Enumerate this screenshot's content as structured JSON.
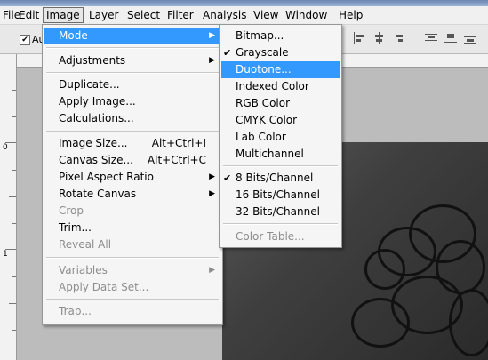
{
  "menubar": {
    "items": [
      "File",
      "Edit",
      "Image",
      "Layer",
      "Select",
      "Filter",
      "Analysis",
      "View",
      "Window",
      "Help"
    ],
    "active": "Image"
  },
  "options_bar": {
    "auto_select_label": "Au"
  },
  "ruler": {
    "vertical_marks": [
      "0",
      "1"
    ]
  },
  "image_menu": {
    "groups": [
      [
        {
          "label": "Mode",
          "submenu": true,
          "highlighted": true
        }
      ],
      [
        {
          "label": "Adjustments",
          "submenu": true
        }
      ],
      [
        {
          "label": "Duplicate..."
        },
        {
          "label": "Apply Image..."
        },
        {
          "label": "Calculations..."
        }
      ],
      [
        {
          "label": "Image Size...",
          "shortcut": "Alt+Ctrl+I"
        },
        {
          "label": "Canvas Size...",
          "shortcut": "Alt+Ctrl+C"
        },
        {
          "label": "Pixel Aspect Ratio",
          "submenu": true
        },
        {
          "label": "Rotate Canvas",
          "submenu": true
        },
        {
          "label": "Crop",
          "disabled": true
        },
        {
          "label": "Trim..."
        },
        {
          "label": "Reveal All",
          "disabled": true
        }
      ],
      [
        {
          "label": "Variables",
          "submenu": true,
          "disabled": true
        },
        {
          "label": "Apply Data Set...",
          "disabled": true
        }
      ],
      [
        {
          "label": "Trap...",
          "disabled": true
        }
      ]
    ]
  },
  "mode_submenu": {
    "groups": [
      [
        {
          "label": "Bitmap..."
        },
        {
          "label": "Grayscale",
          "checked": true
        },
        {
          "label": "Duotone...",
          "highlighted": true
        },
        {
          "label": "Indexed Color"
        },
        {
          "label": "RGB Color"
        },
        {
          "label": "CMYK Color"
        },
        {
          "label": "Lab Color"
        },
        {
          "label": "Multichannel"
        }
      ],
      [
        {
          "label": "8 Bits/Channel",
          "checked": true
        },
        {
          "label": "16 Bits/Channel"
        },
        {
          "label": "32 Bits/Channel"
        }
      ],
      [
        {
          "label": "Color Table...",
          "disabled": true
        }
      ]
    ]
  },
  "colors": {
    "highlight": "#3399ff",
    "menu_bg": "#f5f5f5",
    "disabled": "#8d8d8d"
  }
}
